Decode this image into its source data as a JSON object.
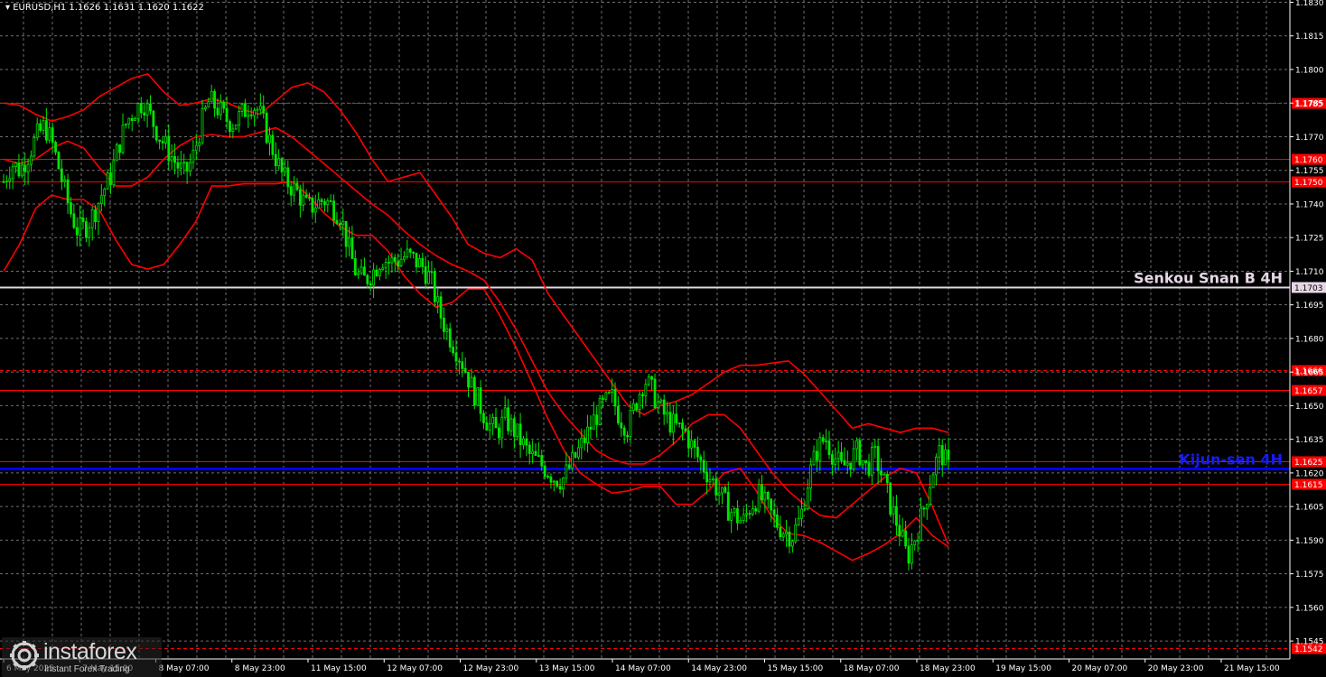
{
  "symbol_header": "EURUSD,H1  1.1626 1.1631 1.1620 1.1622",
  "watermark": {
    "name": "instaforex",
    "tagline": "Instant Forex Trading"
  },
  "chart_data": {
    "type": "candlestick",
    "symbol": "EURUSD",
    "timeframe": "H1",
    "ohlc_last": {
      "open": 1.1626,
      "high": 1.1631,
      "low": 1.162,
      "close": 1.1622
    },
    "y_range": [
      1.1537,
      1.1831
    ],
    "y_ticks": [
      "1.1830",
      "1.1815",
      "1.1800",
      "1.1785",
      "1.1770",
      "1.1755",
      "1.1740",
      "1.1725",
      "1.1710",
      "1.1695",
      "1.1680",
      "1.1665",
      "1.1650",
      "1.1635",
      "1.1620",
      "1.1605",
      "1.1590",
      "1.1575",
      "1.1560",
      "1.1545"
    ],
    "x_ticks": [
      "6 May 2025",
      "7 May 15:00",
      "8 May 07:00",
      "8 May 23:00",
      "11 May 15:00",
      "12 May 07:00",
      "12 May 23:00",
      "13 May 15:00",
      "14 May 07:00",
      "14 May 23:00",
      "15 May 15:00",
      "18 May 07:00",
      "18 May 23:00",
      "19 May 15:00",
      "20 May 07:00",
      "20 May 23:00",
      "21 May 15:00"
    ],
    "grid": true,
    "horizontal_levels": [
      {
        "price": 1.1785,
        "label": "1.1785",
        "style": "dashed",
        "color": "#ff0000"
      },
      {
        "price": 1.176,
        "label": "1.1760",
        "style": "solid",
        "color": "#ff0000"
      },
      {
        "price": 1.175,
        "label": "1.1750",
        "style": "solid",
        "color": "#ff0000"
      },
      {
        "price": 1.1703,
        "label": "1.1703",
        "style": "solid",
        "color": "#e6d7e6",
        "name": "Senkou Snan B 4H"
      },
      {
        "price": 1.1666,
        "label": "1.1666",
        "style": "dashed",
        "color": "#ff0000"
      },
      {
        "price": 1.1657,
        "label": "1.1657",
        "style": "solid",
        "color": "#ff0000"
      },
      {
        "price": 1.1625,
        "label": "1.1625",
        "style": "solid",
        "color": "#ff0000"
      },
      {
        "price": 1.1622,
        "label": "",
        "style": "solid",
        "color": "#0000ff",
        "name": "Kijun-sen 4H"
      },
      {
        "price": 1.1615,
        "label": "1.1615",
        "style": "solid",
        "color": "#ff0000"
      },
      {
        "price": 1.1542,
        "label": "1.1542",
        "style": "dashed",
        "color": "#ff0000"
      }
    ],
    "price_path": [
      1.175,
      1.1758,
      1.1755,
      1.1762,
      1.177,
      1.1775,
      1.1766,
      1.1752,
      1.1738,
      1.1728,
      1.173,
      1.1736,
      1.1745,
      1.1752,
      1.1766,
      1.1777,
      1.1782,
      1.1786,
      1.1778,
      1.177,
      1.1764,
      1.1758,
      1.1753,
      1.176,
      1.1775,
      1.1786,
      1.1783,
      1.1778,
      1.1776,
      1.178,
      1.1785,
      1.1782,
      1.1772,
      1.1762,
      1.1752,
      1.1748,
      1.1744,
      1.1738,
      1.174,
      1.1742,
      1.1739,
      1.1735,
      1.172,
      1.1708,
      1.1706,
      1.171,
      1.1716,
      1.1714,
      1.1715,
      1.1717,
      1.1715,
      1.1712,
      1.1706,
      1.1692,
      1.1683,
      1.1676,
      1.1668,
      1.1658,
      1.165,
      1.1642,
      1.1638,
      1.1644,
      1.164,
      1.1634,
      1.1628,
      1.1625,
      1.1622,
      1.1618,
      1.1617,
      1.1623,
      1.163,
      1.1637,
      1.1645,
      1.165,
      1.1654,
      1.1645,
      1.164,
      1.1652,
      1.1662,
      1.1656,
      1.1648,
      1.1643,
      1.164,
      1.1638,
      1.163,
      1.1624,
      1.1618,
      1.1612,
      1.1605,
      1.1601,
      1.1598,
      1.1606,
      1.161,
      1.1604,
      1.1598,
      1.1594,
      1.1592,
      1.16,
      1.1618,
      1.163,
      1.1636,
      1.1628,
      1.1622,
      1.1626,
      1.163,
      1.1622,
      1.1628,
      1.1618,
      1.1605,
      1.1595,
      1.1582,
      1.1592,
      1.1604,
      1.162,
      1.163,
      1.1622
    ],
    "overlays": [
      {
        "name": "bollinger-upper",
        "color": "#ff0000",
        "values": [
          1.1785,
          1.1784,
          1.178,
          1.1777,
          1.1779,
          1.1782,
          1.1788,
          1.1792,
          1.1796,
          1.1798,
          1.179,
          1.1784,
          1.1785,
          1.1787,
          1.1785,
          1.1782,
          1.178,
          1.1786,
          1.1792,
          1.1794,
          1.179,
          1.1782,
          1.1772,
          1.176,
          1.175,
          1.1752,
          1.1754,
          1.1744,
          1.1734,
          1.1722,
          1.1718,
          1.1716,
          1.172,
          1.1715,
          1.17,
          1.169,
          1.168,
          1.167,
          1.166,
          1.165,
          1.1646,
          1.165,
          1.1652,
          1.1655,
          1.166,
          1.1665,
          1.1668,
          1.1668,
          1.1669,
          1.167,
          1.1664,
          1.1656,
          1.1648,
          1.164,
          1.1642,
          1.164,
          1.1638,
          1.164,
          1.164,
          1.1638
        ]
      },
      {
        "name": "bollinger-middle",
        "color": "#ff0000",
        "values": [
          1.176,
          1.1758,
          1.176,
          1.1765,
          1.1768,
          1.1765,
          1.1756,
          1.1748,
          1.1748,
          1.1752,
          1.176,
          1.1766,
          1.177,
          1.1771,
          1.177,
          1.177,
          1.1772,
          1.1774,
          1.177,
          1.1764,
          1.1758,
          1.1752,
          1.1746,
          1.174,
          1.1735,
          1.1728,
          1.1722,
          1.1717,
          1.1713,
          1.171,
          1.1706,
          1.1696,
          1.1684,
          1.167,
          1.1656,
          1.1646,
          1.1638,
          1.163,
          1.1626,
          1.1624,
          1.1624,
          1.1628,
          1.1634,
          1.1642,
          1.1646,
          1.1646,
          1.164,
          1.163,
          1.162,
          1.1612,
          1.1606,
          1.1601,
          1.16,
          1.1606,
          1.1612,
          1.1618,
          1.1622,
          1.162,
          1.1605,
          1.1588
        ]
      },
      {
        "name": "bollinger-lower",
        "color": "#ff0000",
        "values": [
          1.171,
          1.1722,
          1.1738,
          1.1744,
          1.1742,
          1.1742,
          1.1737,
          1.1724,
          1.1713,
          1.1711,
          1.1713,
          1.1722,
          1.1732,
          1.1748,
          1.1748,
          1.1749,
          1.1749,
          1.1749,
          1.175,
          1.1744,
          1.1736,
          1.173,
          1.1726,
          1.1726,
          1.1719,
          1.1708,
          1.17,
          1.1694,
          1.1696,
          1.1702,
          1.1702,
          1.169,
          1.1676,
          1.166,
          1.1644,
          1.163,
          1.162,
          1.1615,
          1.1611,
          1.1612,
          1.1614,
          1.1614,
          1.1606,
          1.1606,
          1.1612,
          1.162,
          1.1622,
          1.1612,
          1.16,
          1.1593,
          1.1592,
          1.1589,
          1.1585,
          1.1581,
          1.1584,
          1.1588,
          1.1593,
          1.16,
          1.1592,
          1.1587
        ]
      }
    ]
  }
}
